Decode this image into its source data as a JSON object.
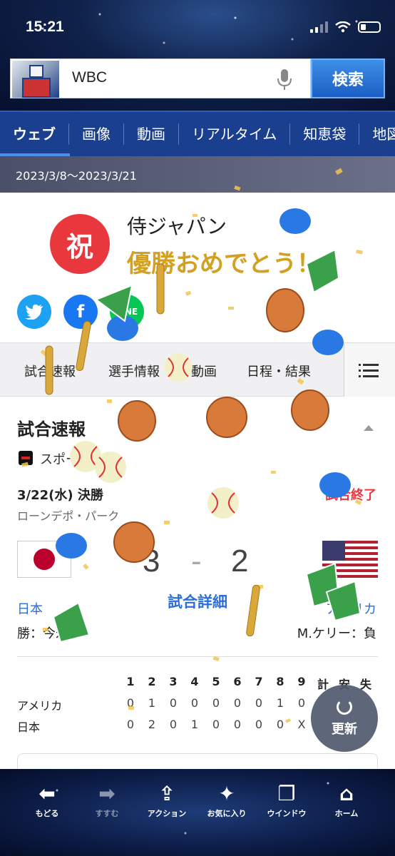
{
  "status_bar": {
    "time": "15:21"
  },
  "search": {
    "query": "WBC",
    "button_label": "検索"
  },
  "nav_tabs": [
    {
      "label": "ウェブ",
      "active": true
    },
    {
      "label": "画像"
    },
    {
      "label": "動画"
    },
    {
      "label": "リアルタイム"
    },
    {
      "label": "知恵袋"
    },
    {
      "label": "地図"
    }
  ],
  "date_range": "2023/3/8〜2023/3/21",
  "celebration": {
    "badge": "祝",
    "team_name": "侍ジャパン",
    "message": "優勝おめでとう！",
    "share": [
      "twitter-icon",
      "facebook-icon",
      "line-icon"
    ]
  },
  "sub_tabs": [
    "試合速報",
    "選手情報",
    "動画",
    "日程・結果"
  ],
  "game": {
    "section_title": "試合速報",
    "source": "スポーツナビ",
    "date": "3/22(水) 決勝",
    "status": "試合終了",
    "venue": "ローンデポ・パーク",
    "home_team": "日本",
    "away_team": "アメリカ",
    "home_score": "3",
    "separator": "-",
    "away_score": "2",
    "detail_link": "試合詳細",
    "winning_pitcher": "勝：今永",
    "losing_pitcher": "M.ケリー：負"
  },
  "linescore": {
    "headers": [
      "1",
      "2",
      "3",
      "4",
      "5",
      "6",
      "7",
      "8",
      "9",
      "計",
      "安",
      "失"
    ],
    "rows": [
      {
        "team": "アメリカ",
        "cells": [
          "0",
          "1",
          "0",
          "0",
          "0",
          "0",
          "0",
          "1",
          "0"
        ]
      },
      {
        "team": "日本",
        "cells": [
          "0",
          "2",
          "0",
          "1",
          "0",
          "0",
          "0",
          "0",
          "X"
        ]
      }
    ]
  },
  "refresh": {
    "label": "更新"
  },
  "toolbar": [
    {
      "label": "もどる",
      "icon": "arrow-left-icon",
      "glyph": "⬅"
    },
    {
      "label": "すすむ",
      "icon": "arrow-right-icon",
      "glyph": "➡",
      "disabled": true
    },
    {
      "label": "アクション",
      "icon": "share-action-icon",
      "glyph": "⇪"
    },
    {
      "label": "お気に入り",
      "icon": "favorites-icon",
      "glyph": "✦"
    },
    {
      "label": "ウインドウ",
      "icon": "window-icon",
      "glyph": "❐"
    },
    {
      "label": "ホーム",
      "icon": "home-icon",
      "glyph": "⌂"
    }
  ],
  "colors": {
    "accent_blue": "#2a6fdb",
    "nav_blue": "#1b3f8f",
    "celebrate_gold": "#d4a020",
    "badge_red": "#e8383d"
  }
}
